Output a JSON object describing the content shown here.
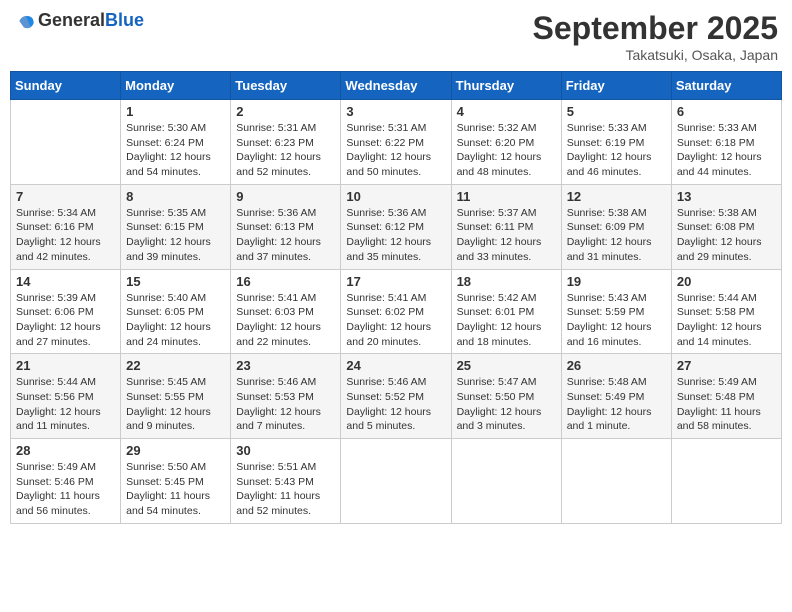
{
  "header": {
    "logo_general": "General",
    "logo_blue": "Blue",
    "title": "September 2025",
    "location": "Takatsuki, Osaka, Japan"
  },
  "days_of_week": [
    "Sunday",
    "Monday",
    "Tuesday",
    "Wednesday",
    "Thursday",
    "Friday",
    "Saturday"
  ],
  "weeks": [
    [
      {
        "day": "",
        "info": ""
      },
      {
        "day": "1",
        "info": "Sunrise: 5:30 AM\nSunset: 6:24 PM\nDaylight: 12 hours\nand 54 minutes."
      },
      {
        "day": "2",
        "info": "Sunrise: 5:31 AM\nSunset: 6:23 PM\nDaylight: 12 hours\nand 52 minutes."
      },
      {
        "day": "3",
        "info": "Sunrise: 5:31 AM\nSunset: 6:22 PM\nDaylight: 12 hours\nand 50 minutes."
      },
      {
        "day": "4",
        "info": "Sunrise: 5:32 AM\nSunset: 6:20 PM\nDaylight: 12 hours\nand 48 minutes."
      },
      {
        "day": "5",
        "info": "Sunrise: 5:33 AM\nSunset: 6:19 PM\nDaylight: 12 hours\nand 46 minutes."
      },
      {
        "day": "6",
        "info": "Sunrise: 5:33 AM\nSunset: 6:18 PM\nDaylight: 12 hours\nand 44 minutes."
      }
    ],
    [
      {
        "day": "7",
        "info": "Sunrise: 5:34 AM\nSunset: 6:16 PM\nDaylight: 12 hours\nand 42 minutes."
      },
      {
        "day": "8",
        "info": "Sunrise: 5:35 AM\nSunset: 6:15 PM\nDaylight: 12 hours\nand 39 minutes."
      },
      {
        "day": "9",
        "info": "Sunrise: 5:36 AM\nSunset: 6:13 PM\nDaylight: 12 hours\nand 37 minutes."
      },
      {
        "day": "10",
        "info": "Sunrise: 5:36 AM\nSunset: 6:12 PM\nDaylight: 12 hours\nand 35 minutes."
      },
      {
        "day": "11",
        "info": "Sunrise: 5:37 AM\nSunset: 6:11 PM\nDaylight: 12 hours\nand 33 minutes."
      },
      {
        "day": "12",
        "info": "Sunrise: 5:38 AM\nSunset: 6:09 PM\nDaylight: 12 hours\nand 31 minutes."
      },
      {
        "day": "13",
        "info": "Sunrise: 5:38 AM\nSunset: 6:08 PM\nDaylight: 12 hours\nand 29 minutes."
      }
    ],
    [
      {
        "day": "14",
        "info": "Sunrise: 5:39 AM\nSunset: 6:06 PM\nDaylight: 12 hours\nand 27 minutes."
      },
      {
        "day": "15",
        "info": "Sunrise: 5:40 AM\nSunset: 6:05 PM\nDaylight: 12 hours\nand 24 minutes."
      },
      {
        "day": "16",
        "info": "Sunrise: 5:41 AM\nSunset: 6:03 PM\nDaylight: 12 hours\nand 22 minutes."
      },
      {
        "day": "17",
        "info": "Sunrise: 5:41 AM\nSunset: 6:02 PM\nDaylight: 12 hours\nand 20 minutes."
      },
      {
        "day": "18",
        "info": "Sunrise: 5:42 AM\nSunset: 6:01 PM\nDaylight: 12 hours\nand 18 minutes."
      },
      {
        "day": "19",
        "info": "Sunrise: 5:43 AM\nSunset: 5:59 PM\nDaylight: 12 hours\nand 16 minutes."
      },
      {
        "day": "20",
        "info": "Sunrise: 5:44 AM\nSunset: 5:58 PM\nDaylight: 12 hours\nand 14 minutes."
      }
    ],
    [
      {
        "day": "21",
        "info": "Sunrise: 5:44 AM\nSunset: 5:56 PM\nDaylight: 12 hours\nand 11 minutes."
      },
      {
        "day": "22",
        "info": "Sunrise: 5:45 AM\nSunset: 5:55 PM\nDaylight: 12 hours\nand 9 minutes."
      },
      {
        "day": "23",
        "info": "Sunrise: 5:46 AM\nSunset: 5:53 PM\nDaylight: 12 hours\nand 7 minutes."
      },
      {
        "day": "24",
        "info": "Sunrise: 5:46 AM\nSunset: 5:52 PM\nDaylight: 12 hours\nand 5 minutes."
      },
      {
        "day": "25",
        "info": "Sunrise: 5:47 AM\nSunset: 5:50 PM\nDaylight: 12 hours\nand 3 minutes."
      },
      {
        "day": "26",
        "info": "Sunrise: 5:48 AM\nSunset: 5:49 PM\nDaylight: 12 hours\nand 1 minute."
      },
      {
        "day": "27",
        "info": "Sunrise: 5:49 AM\nSunset: 5:48 PM\nDaylight: 11 hours\nand 58 minutes."
      }
    ],
    [
      {
        "day": "28",
        "info": "Sunrise: 5:49 AM\nSunset: 5:46 PM\nDaylight: 11 hours\nand 56 minutes."
      },
      {
        "day": "29",
        "info": "Sunrise: 5:50 AM\nSunset: 5:45 PM\nDaylight: 11 hours\nand 54 minutes."
      },
      {
        "day": "30",
        "info": "Sunrise: 5:51 AM\nSunset: 5:43 PM\nDaylight: 11 hours\nand 52 minutes."
      },
      {
        "day": "",
        "info": ""
      },
      {
        "day": "",
        "info": ""
      },
      {
        "day": "",
        "info": ""
      },
      {
        "day": "",
        "info": ""
      }
    ]
  ]
}
